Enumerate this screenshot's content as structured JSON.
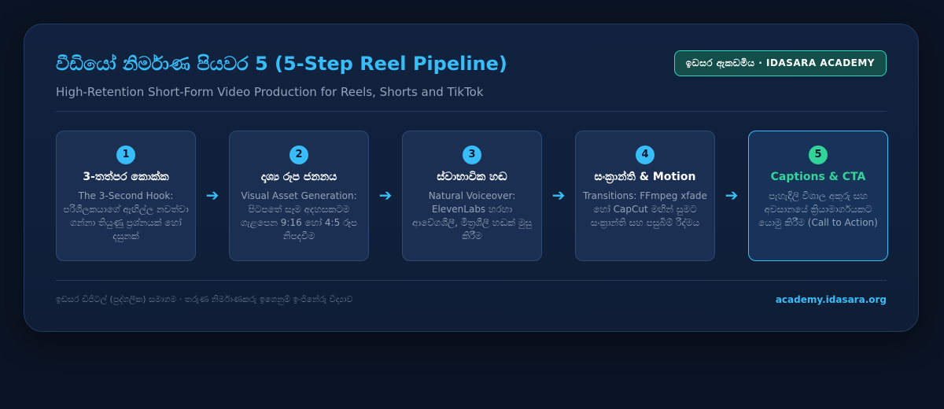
{
  "header": {
    "title": "වීඩියෝ නිර්මාණ පියවර 5 (5-Step Reel Pipeline)",
    "subtitle": "High-Retention Short-Form Video Production for Reels, Shorts and TikTok",
    "badge": "ඉඩසර ඇකඩමිය · IDASARA ACADEMY"
  },
  "steps": [
    {
      "number": "1",
      "title": "3-තත්පර කොක්ක",
      "description": "The 3-Second Hook: පරිශීලකයාගේ ඇඟිල්ල නවත්වා ගන්නා තියුණු ප්‍රශ්නයක් හෝ දසුනක්"
    },
    {
      "number": "2",
      "title": "දෘශ්‍ය රූප ජනනය",
      "description": "Visual Asset Generation: පිටපතේ සෑම අදහසකටම ගැළපෙන 9:16 හෝ 4:5 රූප නිපදවීම"
    },
    {
      "number": "3",
      "title": "ස්වාභාවික හඬ",
      "description": "Natural Voiceover: ElevenLabs හරහා ආවේගශීලී, මිත්‍රශීලී හඬක් මුසු කිරීම"
    },
    {
      "number": "4",
      "title": "සංක්‍රාන්ති & Motion",
      "description": "Transitions: FFmpeg xfade හෝ CapCut මඟින් සුමට සංක්‍රාන්ති සහ පසුබිම් රිද්මය"
    },
    {
      "number": "5",
      "title": "Captions & CTA",
      "description": "පැහැදිලි විශාල අකුරු සහ අවසානයේ ක්‍රියාමාර්ගයකට යොමු කිරීම (Call to Action)"
    }
  ],
  "footer": {
    "left": "ඉඩසර ඩිජිටල් (පුද්ගලික) සමාගම · තරුණ නිර්මාණකරු ඉගෙනුම් ඉංජිනේරු විද්‍යාව",
    "right": "academy.idasara.org"
  },
  "colors": {
    "accent": "#38bdf8",
    "highlight": "#34d399",
    "badge_bg": "#134e4a",
    "badge_border": "#2dd4bf",
    "card_bg": "#112240",
    "page_bg": "#0b1424"
  }
}
